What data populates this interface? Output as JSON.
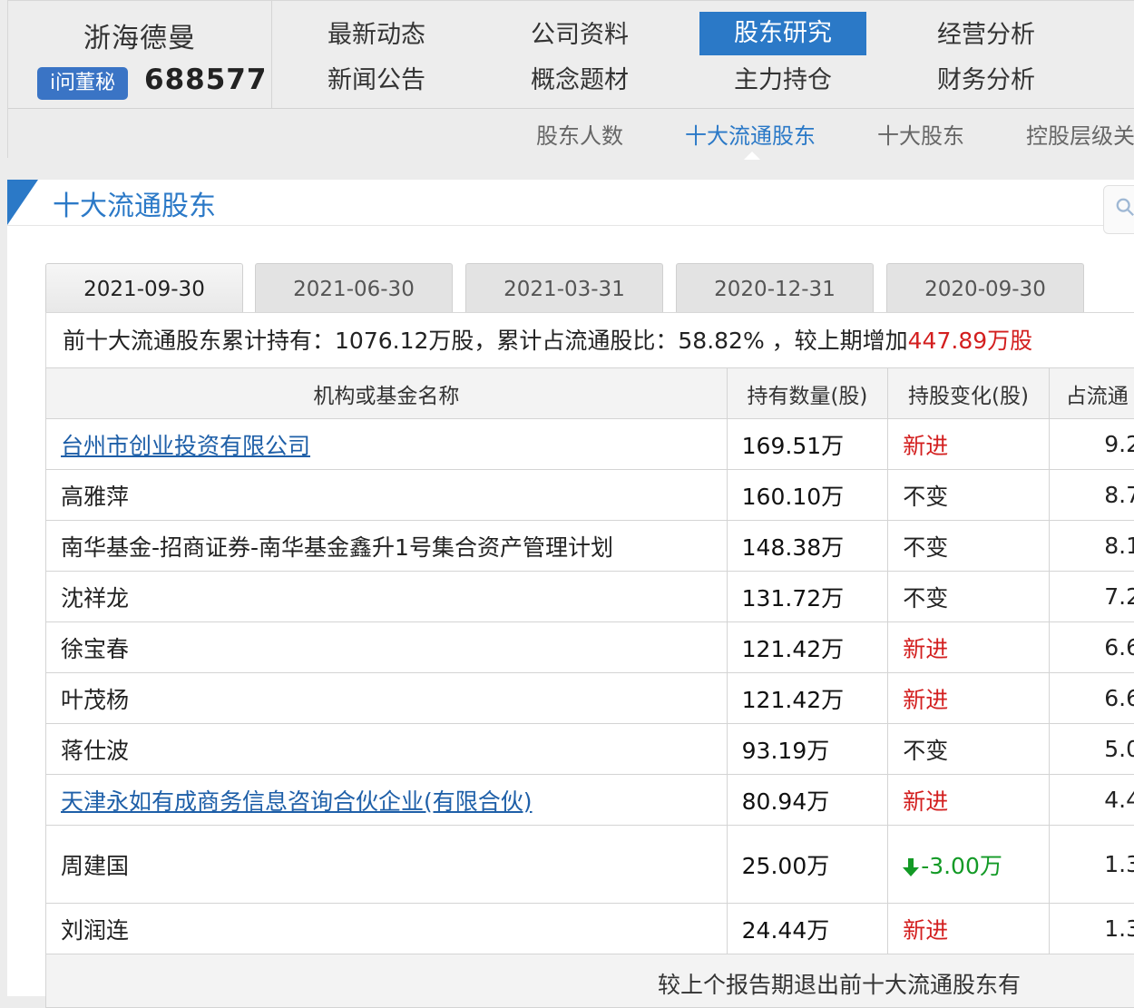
{
  "company": {
    "name": "浙海德曼",
    "badge": "i问董秘",
    "code": "688577"
  },
  "nav": [
    {
      "label": "最新动态"
    },
    {
      "label": "公司资料"
    },
    {
      "label": "股东研究"
    },
    {
      "label": "经营分析"
    },
    {
      "label": "新闻公告"
    },
    {
      "label": "概念题材"
    },
    {
      "label": "主力持仓"
    },
    {
      "label": "财务分析"
    }
  ],
  "subnav": [
    {
      "label": "股东人数"
    },
    {
      "label": "十大流通股东"
    },
    {
      "label": "十大股东"
    },
    {
      "label": "控股层级关"
    }
  ],
  "section": {
    "title": "十大流通股东"
  },
  "tabs": [
    {
      "label": "2021-09-30"
    },
    {
      "label": "2021-06-30"
    },
    {
      "label": "2021-03-31"
    },
    {
      "label": "2020-12-31"
    },
    {
      "label": "2020-09-30"
    }
  ],
  "summary": {
    "prefix": "前十大流通股东累计持有：1076.12万股，累计占流通股比：58.82% ，较上期增加",
    "increase": "447.89万股"
  },
  "table": {
    "headers": [
      "机构或基金名称",
      "持有数量(股)",
      "持股变化(股)",
      "占流通"
    ],
    "rows": [
      {
        "name": "台州市创业投资有限公司",
        "qty": "169.51万",
        "change": "新进",
        "pct": "9.2"
      },
      {
        "name": "高雅萍",
        "qty": "160.10万",
        "change": "不变",
        "pct": "8.7"
      },
      {
        "name": "南华基金-招商证券-南华基金鑫升1号集合资产管理计划",
        "qty": "148.38万",
        "change": "不变",
        "pct": "8.1"
      },
      {
        "name": "沈祥龙",
        "qty": "131.72万",
        "change": "不变",
        "pct": "7.2"
      },
      {
        "name": "徐宝春",
        "qty": "121.42万",
        "change": "新进",
        "pct": "6.6"
      },
      {
        "name": "叶茂杨",
        "qty": "121.42万",
        "change": "新进",
        "pct": "6.6"
      },
      {
        "name": "蒋仕波",
        "qty": "93.19万",
        "change": "不变",
        "pct": "5.0"
      },
      {
        "name": "天津永如有成商务信息咨询合伙企业(有限合伙)",
        "qty": "80.94万",
        "change": "新进",
        "pct": "4.4"
      },
      {
        "name": "周建国",
        "qty": "25.00万",
        "change": "-3.00万",
        "pct": "1.3"
      },
      {
        "name": "刘润连",
        "qty": "24.44万",
        "change": "新进",
        "pct": "1.3"
      }
    ]
  },
  "footer": {
    "text": "较上个报告期退出前十大流通股东有"
  },
  "colors": {
    "accent": "#2b79c7",
    "increase": "#d31f1f",
    "decrease": "#139a26"
  }
}
